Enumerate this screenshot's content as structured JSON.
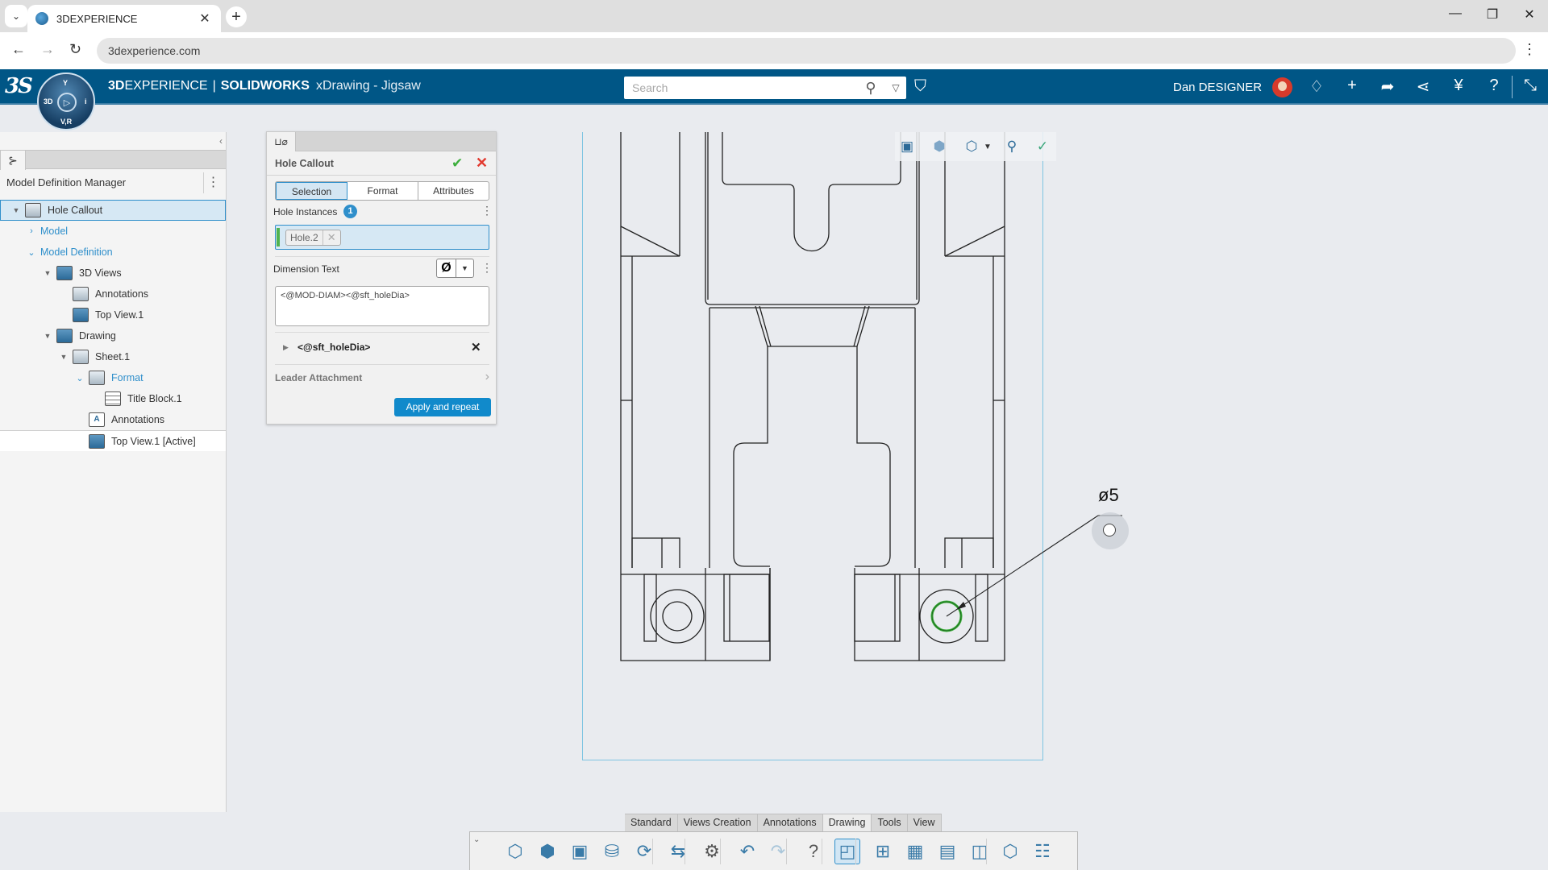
{
  "browser": {
    "tab_title": "3DEXPERIENCE",
    "url": "3dexperience.com",
    "new_tab_label": "+"
  },
  "app": {
    "brand_bold": "3D",
    "brand_rest": "EXPERIENCE",
    "separator": "|",
    "product": "SOLIDWORKS",
    "document": "xDrawing - Jigsaw",
    "compass": {
      "top": "Y",
      "left": "3D",
      "right": "i",
      "bottom": "V,R"
    },
    "search_placeholder": "Search",
    "user_name": "Dan DESIGNER",
    "accent": "#005686"
  },
  "left_panel": {
    "title": "Model Definition Manager",
    "tree": [
      {
        "label": "Hole Callout",
        "level": 0,
        "expander": "▼",
        "icon": "hole-callout-icon",
        "selected": true
      },
      {
        "label": "Model",
        "level": 1,
        "expander": "›",
        "link": true
      },
      {
        "label": "Model Definition",
        "level": 1,
        "expander": "⌄",
        "link": true
      },
      {
        "label": "3D Views",
        "level": 2,
        "expander": "▼",
        "icon": "3d-views-icon"
      },
      {
        "label": "Annotations",
        "level": 3,
        "icon": "annotations-folder-icon"
      },
      {
        "label": "Top View.1",
        "level": 3,
        "icon": "view-icon"
      },
      {
        "label": "Drawing",
        "level": 2,
        "expander": "▼",
        "icon": "drawing-icon"
      },
      {
        "label": "Sheet.1",
        "level": 3,
        "expander": "▼",
        "icon": "sheet-icon"
      },
      {
        "label": "Format",
        "level": 4,
        "expander": "⌄",
        "icon": "format-icon",
        "link": true
      },
      {
        "label": "Title Block.1",
        "level": 5,
        "icon": "table-icon"
      },
      {
        "label": "Annotations",
        "level": 4,
        "icon": "annotations-a-icon"
      },
      {
        "label": "Top View.1 [Active]",
        "level": 4,
        "icon": "view-icon",
        "active": true
      }
    ]
  },
  "property_manager": {
    "tab_glyph": "⊔⌀",
    "title": "Hole Callout",
    "tabs": [
      "Selection",
      "Format",
      "Attributes"
    ],
    "active_tab": "Selection",
    "hole_instances_label": "Hole Instances",
    "hole_instances_count": "1",
    "selected_hole": "Hole.2",
    "dimension_text_label": "Dimension Text",
    "diameter_symbol": "Ø",
    "dimension_text_value": "<@MOD-DIAM><@sft_holeDia>",
    "variable": "<@sft_holeDia>",
    "leader_attachment_label": "Leader Attachment",
    "apply_label": "Apply and repeat"
  },
  "canvas": {
    "callout_text": "ø5",
    "selection_color": "#3cae3c",
    "sheet_border_color": "#7ec4e2"
  },
  "command_manager": {
    "tabs": [
      "Standard",
      "Views Creation",
      "Annotations",
      "Drawing",
      "Tools",
      "View"
    ],
    "active_tab": "Drawing",
    "buttons": [
      "open-icon",
      "save-as-3d-icon",
      "save-icon",
      "save-to-database-icon",
      "refresh-icon",
      "replace-icon",
      "settings-icon",
      "undo-icon",
      "redo-icon",
      "help-icon",
      "model-view-icon",
      "new-sheet-icon",
      "sheet-format-icon",
      "save-sheet-icon",
      "view-layout-icon",
      "3d-box-icon",
      "tree-table-icon"
    ]
  }
}
